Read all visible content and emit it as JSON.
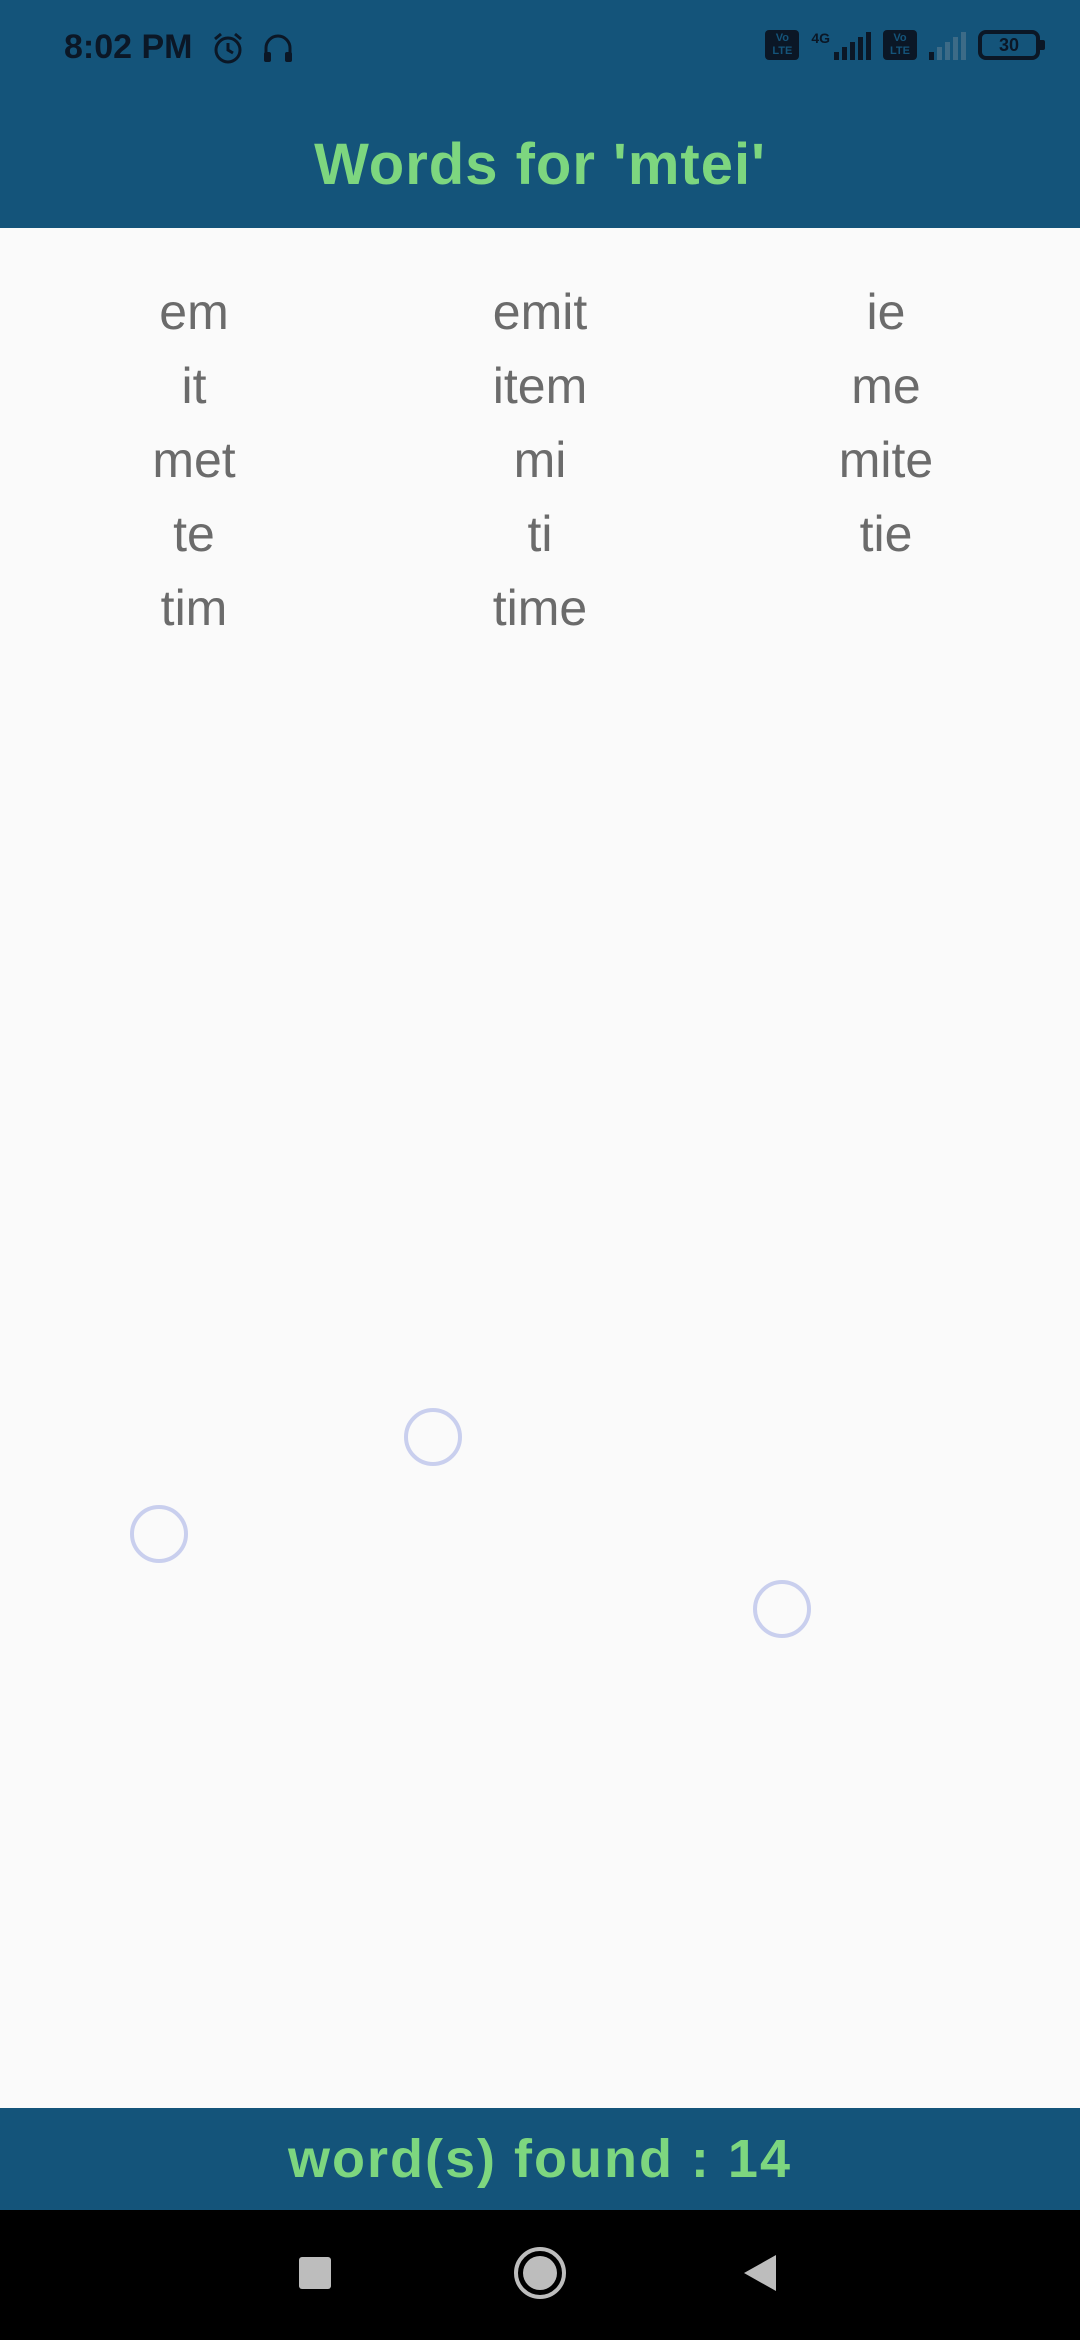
{
  "status_bar": {
    "time": "8:02 PM",
    "left_icons": [
      "alarm-icon",
      "headset-icon"
    ],
    "network_label": "4G",
    "volte_label": "Vo LTE",
    "battery_level": "30"
  },
  "header": {
    "title": "Words for 'mtei'"
  },
  "words": [
    "em",
    "emit",
    "ie",
    "it",
    "item",
    "me",
    "met",
    "mi",
    "mite",
    "te",
    "ti",
    "tie",
    "tim",
    "time"
  ],
  "footer": {
    "found_text": "word(s) found : 14"
  },
  "nav": {
    "buttons": [
      "recents-square-icon",
      "home-circle-icon",
      "back-triangle-icon"
    ]
  },
  "colors": {
    "bar_background": "#14547a",
    "accent_green": "#7dd67f",
    "word_text": "#6b6b6b",
    "page_background": "#fafafa"
  }
}
